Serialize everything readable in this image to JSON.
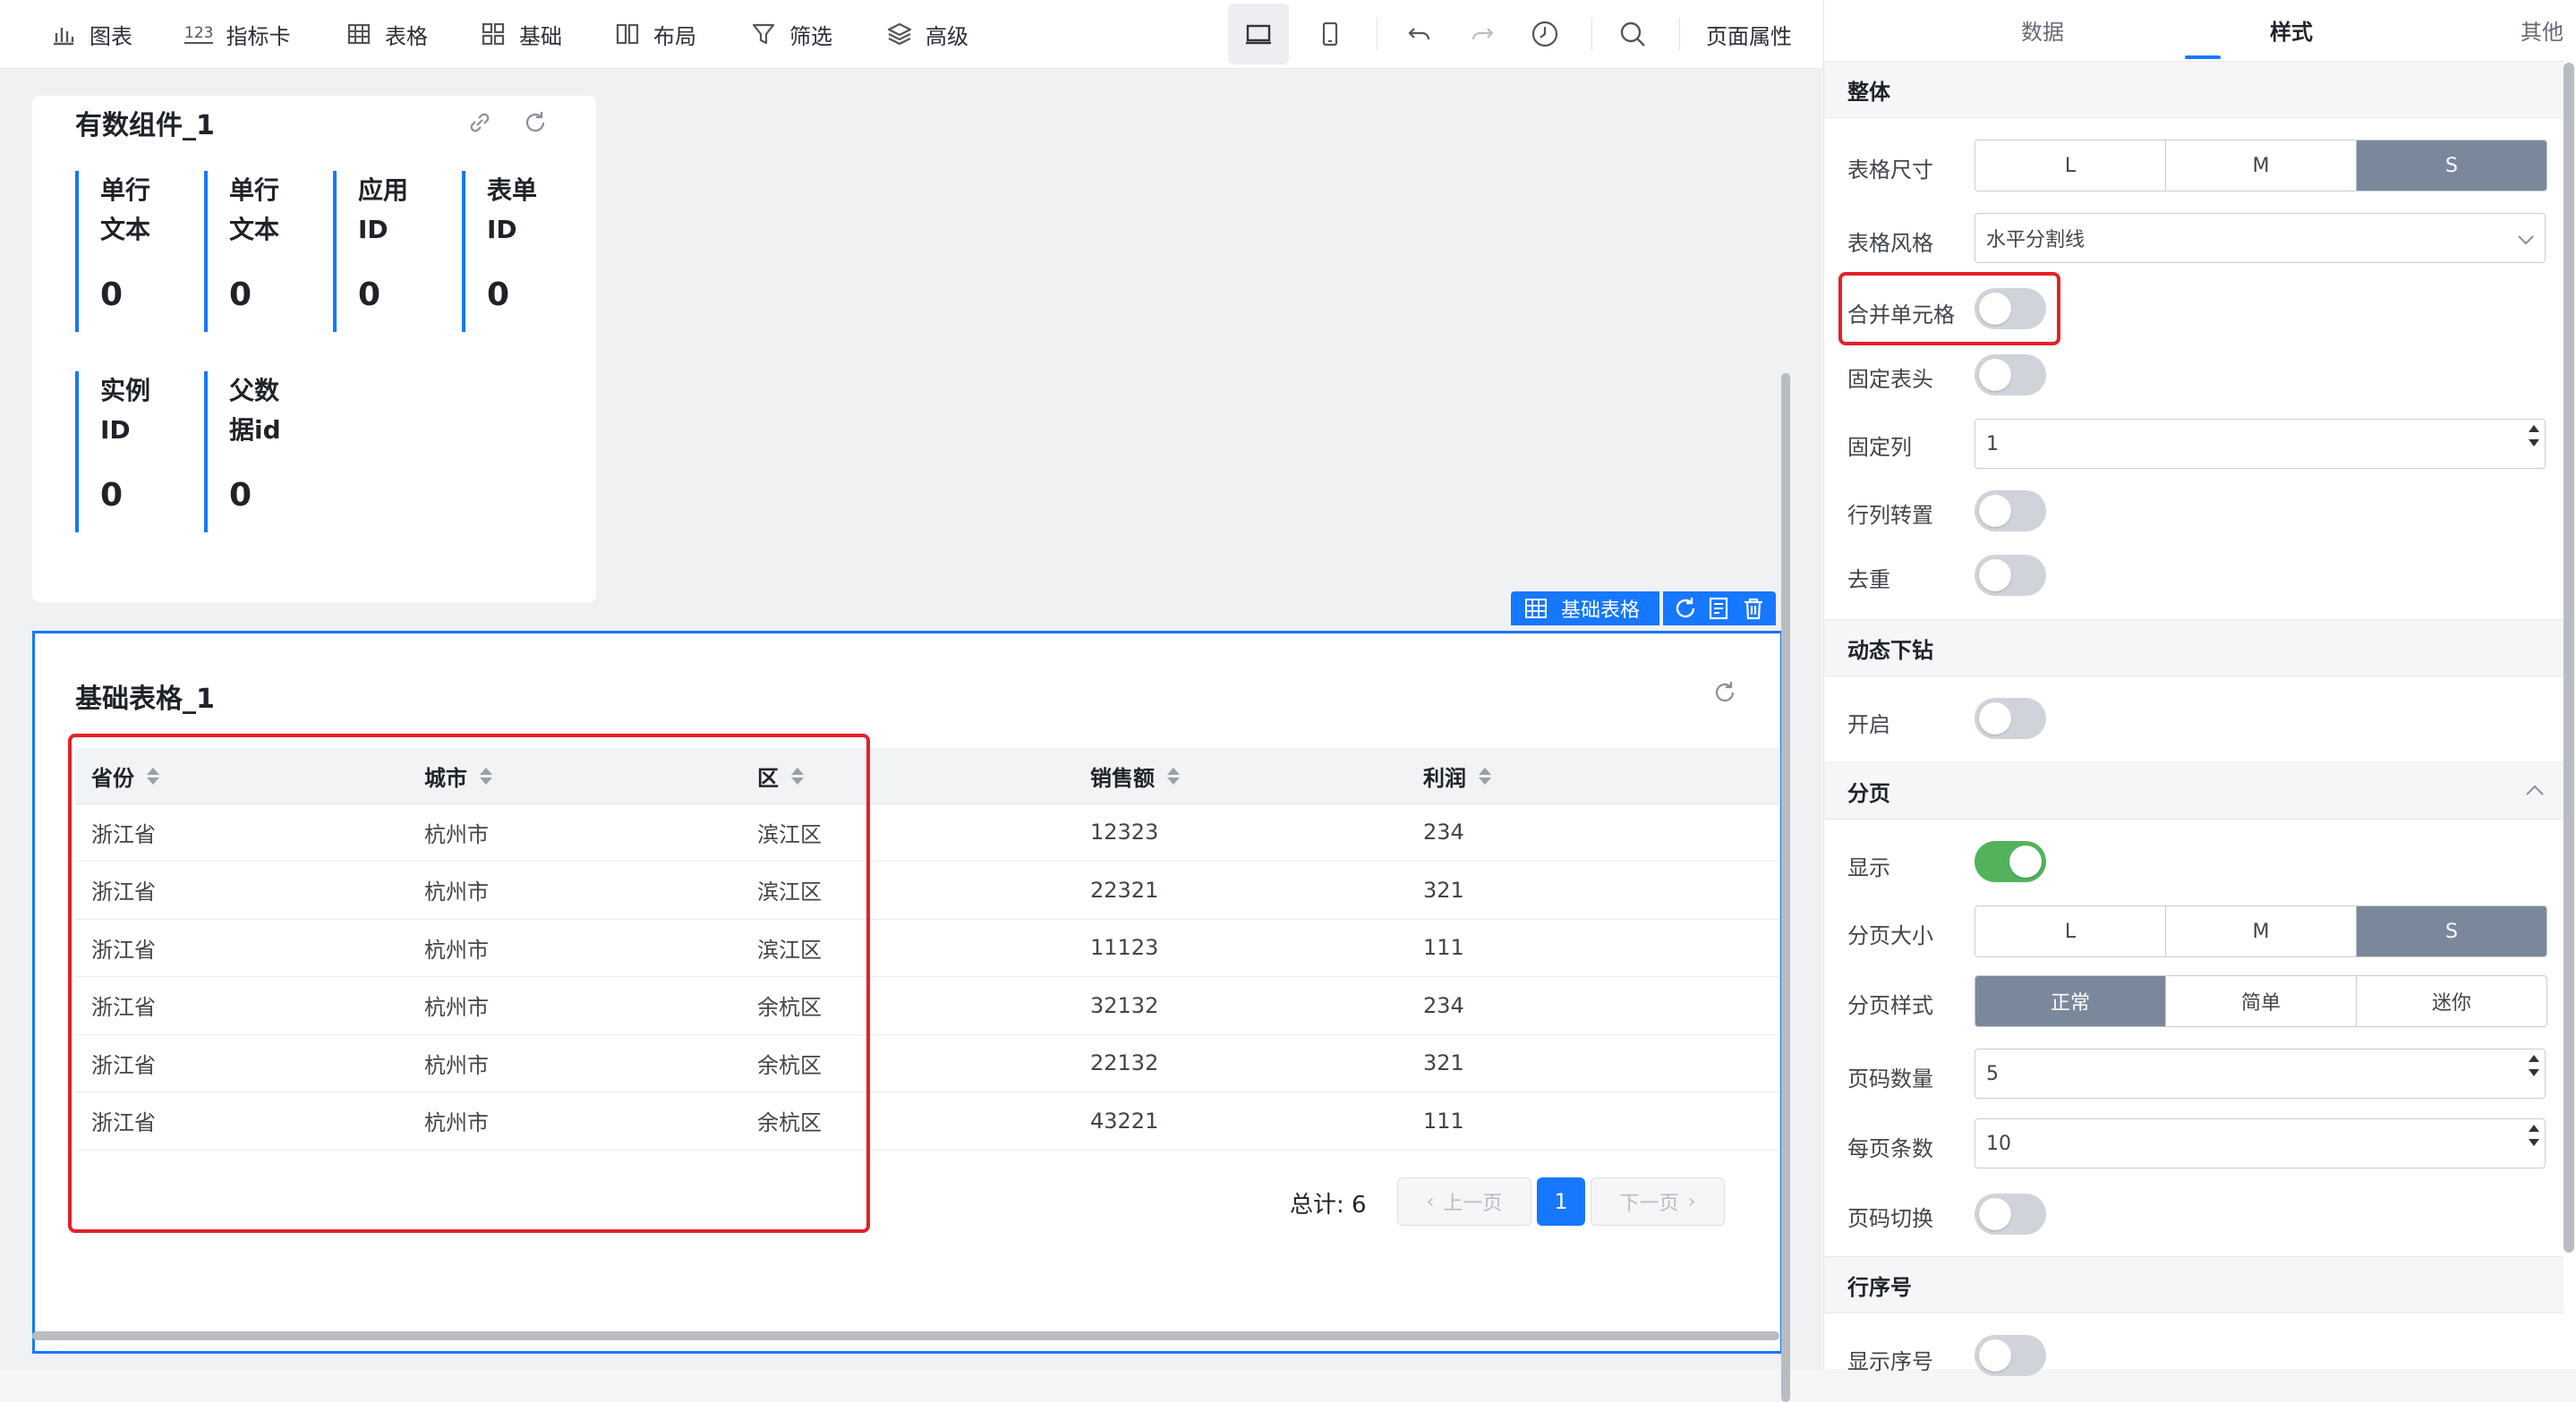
{
  "toolbar": {
    "items": [
      {
        "label": "图表",
        "icon": "bar-chart-icon"
      },
      {
        "label": "指标卡",
        "icon": "123-icon",
        "icon_text": "123"
      },
      {
        "label": "表格",
        "icon": "table-icon"
      },
      {
        "label": "基础",
        "icon": "grid-icon"
      },
      {
        "label": "布局",
        "icon": "layout-icon"
      },
      {
        "label": "筛选",
        "icon": "filter-icon"
      },
      {
        "label": "高级",
        "icon": "layers-icon"
      }
    ],
    "page_props": "页面属性"
  },
  "kpi_card": {
    "title": "有数组件_1",
    "items": [
      {
        "label_line1": "单行",
        "label_line2": "文本",
        "value": "0"
      },
      {
        "label_line1": "单行",
        "label_line2": "文本",
        "value": "0"
      },
      {
        "label_line1": "应用",
        "label_line2": "ID",
        "value": "0"
      },
      {
        "label_line1": "表单",
        "label_line2": "ID",
        "value": "0"
      },
      {
        "label_line1": "实例",
        "label_line2": "ID",
        "value": "0"
      },
      {
        "label_line1": "父数",
        "label_line2": "据id",
        "value": "0"
      }
    ]
  },
  "table_card": {
    "badge": "基础表格",
    "title": "基础表格_1",
    "columns": [
      "省份",
      "城市",
      "区",
      "销售额",
      "利润"
    ],
    "rows": [
      [
        "浙江省",
        "杭州市",
        "滨江区",
        "12323",
        "234"
      ],
      [
        "浙江省",
        "杭州市",
        "滨江区",
        "22321",
        "321"
      ],
      [
        "浙江省",
        "杭州市",
        "滨江区",
        "11123",
        "111"
      ],
      [
        "浙江省",
        "杭州市",
        "余杭区",
        "32132",
        "234"
      ],
      [
        "浙江省",
        "杭州市",
        "余杭区",
        "22132",
        "321"
      ],
      [
        "浙江省",
        "杭州市",
        "余杭区",
        "43221",
        "111"
      ]
    ],
    "total": "总计: 6",
    "prev": "上一页",
    "next": "下一页",
    "page": "1"
  },
  "panel": {
    "tabs": [
      "数据",
      "样式",
      "其他"
    ],
    "active_tab": "样式",
    "sections": {
      "overall": "整体",
      "drill": "动态下钻",
      "paging": "分页",
      "row_no": "行序号"
    },
    "labels": {
      "table_size": "表格尺寸",
      "table_style": "表格风格",
      "merge_cells": "合并单元格",
      "fixed_header": "固定表头",
      "fixed_col": "固定列",
      "transpose": "行列转置",
      "dedup": "去重",
      "enable": "开启",
      "show": "显示",
      "page_size": "分页大小",
      "page_style": "分页样式",
      "page_count": "页码数量",
      "per_page": "每页条数",
      "page_switch": "页码切换",
      "show_row_no": "显示序号"
    },
    "size_options": [
      "L",
      "M",
      "S"
    ],
    "size_selected": "S",
    "table_style_value": "水平分割线",
    "fixed_col_value": "1",
    "page_size_options": [
      "L",
      "M",
      "S"
    ],
    "page_size_selected": "S",
    "page_style_options": [
      "正常",
      "简单",
      "迷你"
    ],
    "page_style_selected": "正常",
    "page_count_value": "5",
    "per_page_value": "10",
    "toggles": {
      "merge": false,
      "fixed_header": false,
      "transpose": false,
      "dedup": false,
      "drill": false,
      "paging_show": true,
      "page_switch": false,
      "row_no": false
    }
  },
  "colors": {
    "accent": "#1677ff",
    "highlight": "#e5202b",
    "toggle_on": "#52b35c",
    "segment_on": "#7a889c"
  }
}
